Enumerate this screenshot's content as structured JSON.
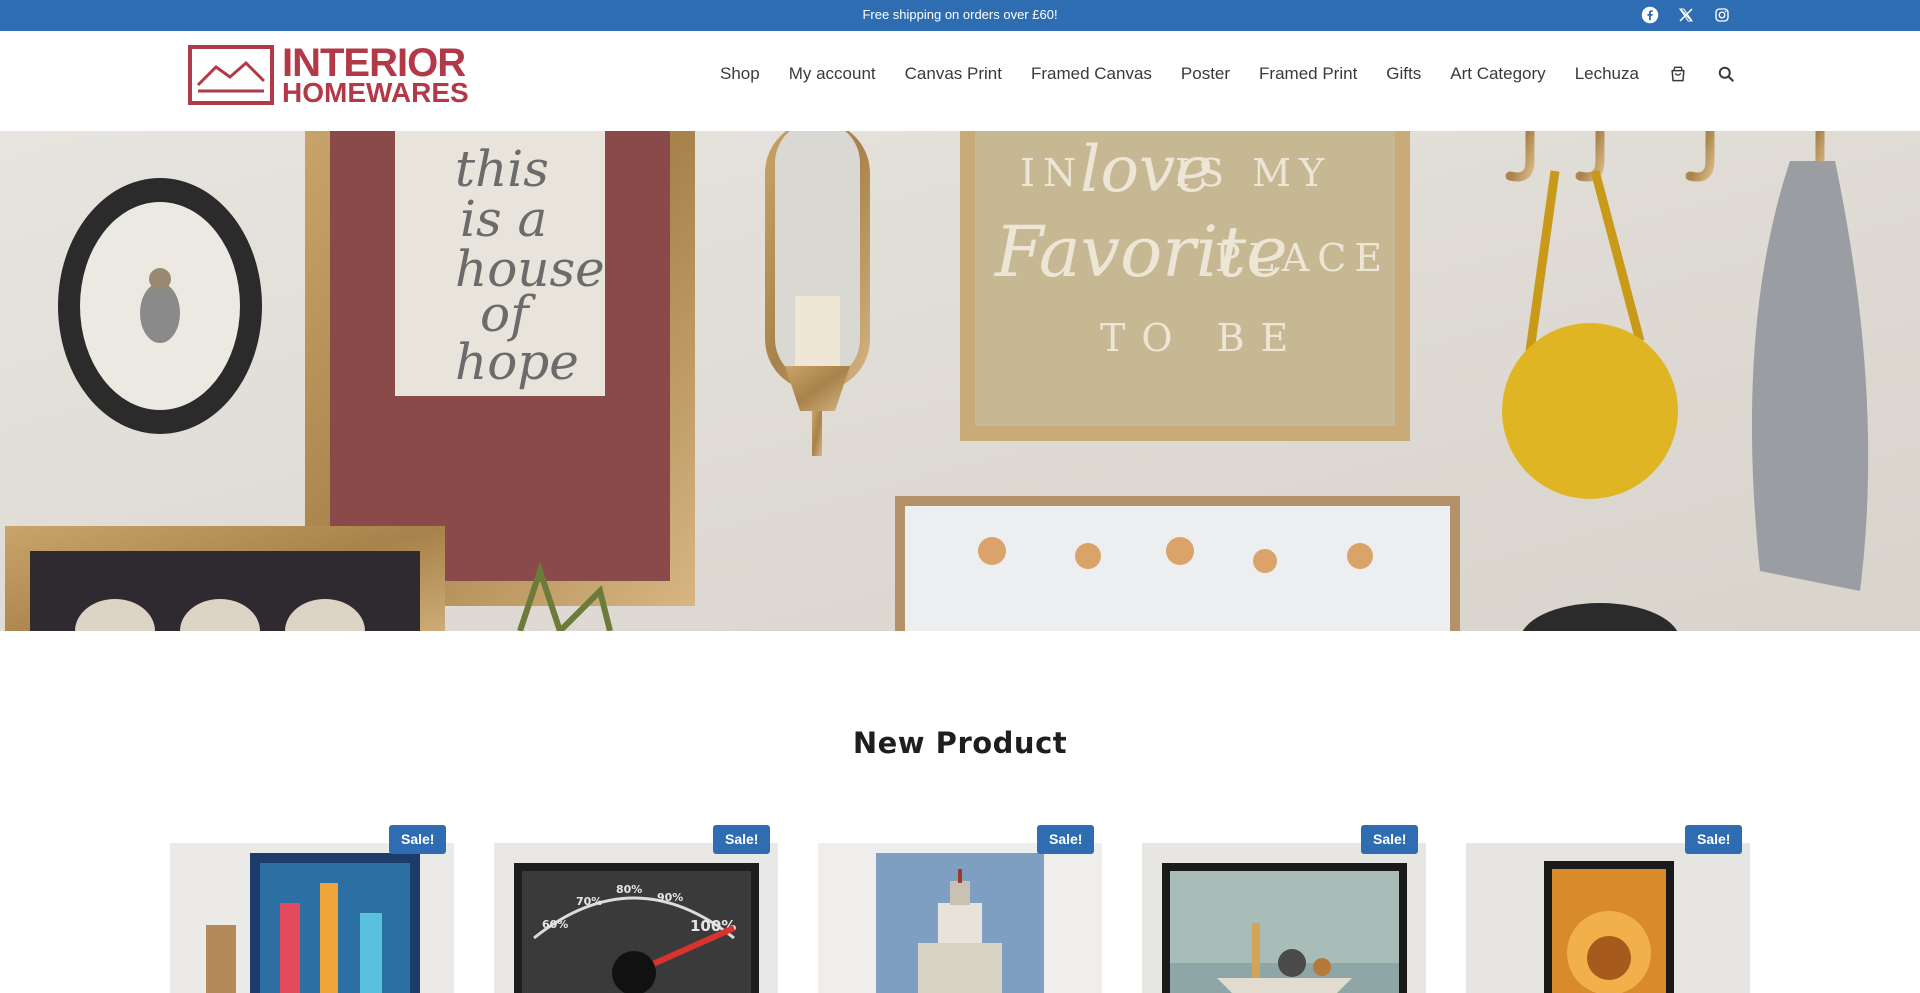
{
  "topbar": {
    "message": "Free shipping on orders over £60!",
    "background": "#2f6db3",
    "social": [
      {
        "icon": "facebook-icon"
      },
      {
        "icon": "x-twitter-icon"
      },
      {
        "icon": "instagram-icon"
      }
    ]
  },
  "brand": {
    "line1": "INTERIOR",
    "line2": "HOMEWARES",
    "color": "#b23a48"
  },
  "nav": {
    "items": [
      {
        "label": "Shop"
      },
      {
        "label": "My account"
      },
      {
        "label": "Canvas Print"
      },
      {
        "label": "Framed Canvas"
      },
      {
        "label": "Poster"
      },
      {
        "label": "Framed Print"
      },
      {
        "label": "Gifts"
      },
      {
        "label": "Art Category"
      },
      {
        "label": "Lechuza"
      }
    ],
    "icons": [
      "cart-icon",
      "search-icon"
    ]
  },
  "hero": {
    "art_text": {
      "frame1_lines": [
        "this",
        "is a",
        "house",
        "of",
        "hope"
      ],
      "frame2_line1": "IN",
      "frame2_script1": "love",
      "frame2_line1b": "IS MY",
      "frame2_script2": "Favorite",
      "frame2_line2b": "PLACE",
      "frame2_line3": "TO BE"
    }
  },
  "section": {
    "title": "New Product"
  },
  "products": [
    {
      "badge": "Sale!"
    },
    {
      "badge": "Sale!",
      "gauge_labels": [
        "60%",
        "70%",
        "80%",
        "90%",
        "100%"
      ]
    },
    {
      "badge": "Sale!"
    },
    {
      "badge": "Sale!"
    },
    {
      "badge": "Sale!"
    }
  ]
}
